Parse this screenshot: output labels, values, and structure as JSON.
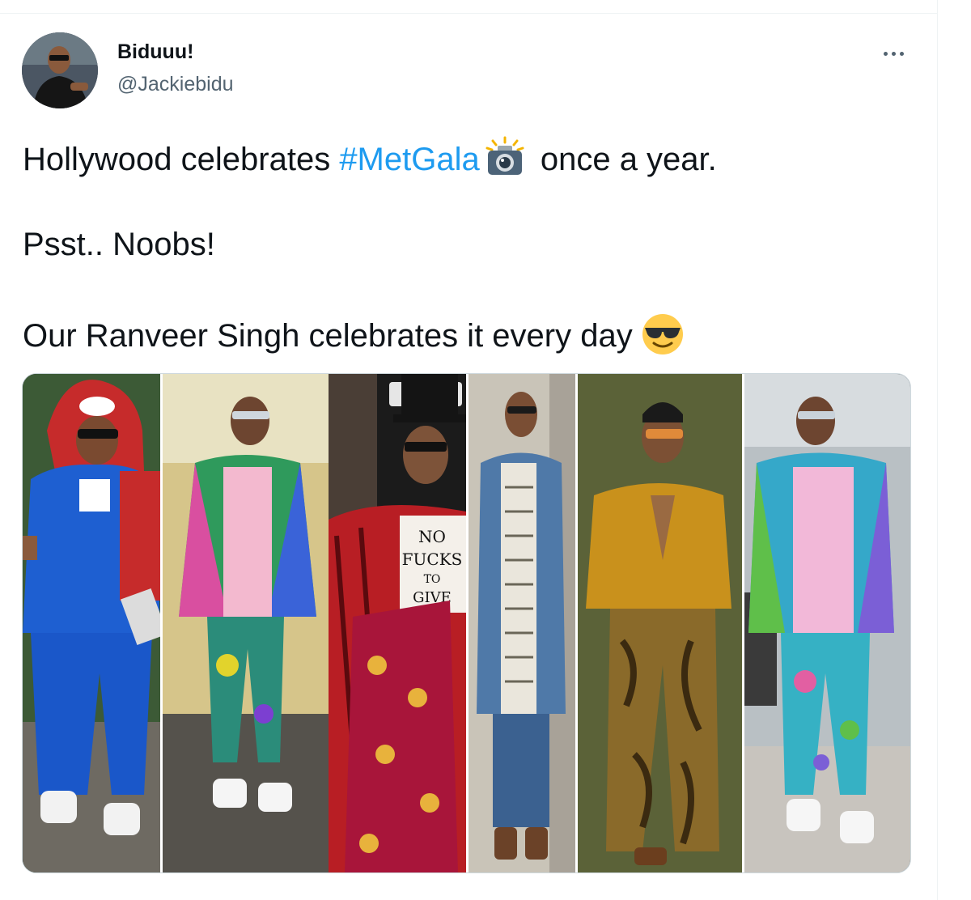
{
  "author": {
    "name": "Biduuu!",
    "handle": "@Jackiebidu"
  },
  "icons": {
    "more": "more-horizontal-icon",
    "camera": "camera-flash-emoji",
    "sunglasses": "smiling-face-with-sunglasses-emoji"
  },
  "tweet": {
    "line1_before": "Hollywood celebrates ",
    "hashtag": "#MetGala",
    "line1_after": " once a year.",
    "line2": "Psst.. Noobs!",
    "line3": "Our Ranveer Singh celebrates it every day"
  },
  "media": {
    "shirt_text": "NO\nFUCKS\nTO\nGIVE"
  },
  "colors": {
    "hashtag": "#1d9bf0",
    "text": "#0f1419",
    "secondary": "#536471",
    "border": "#cfd9de"
  }
}
